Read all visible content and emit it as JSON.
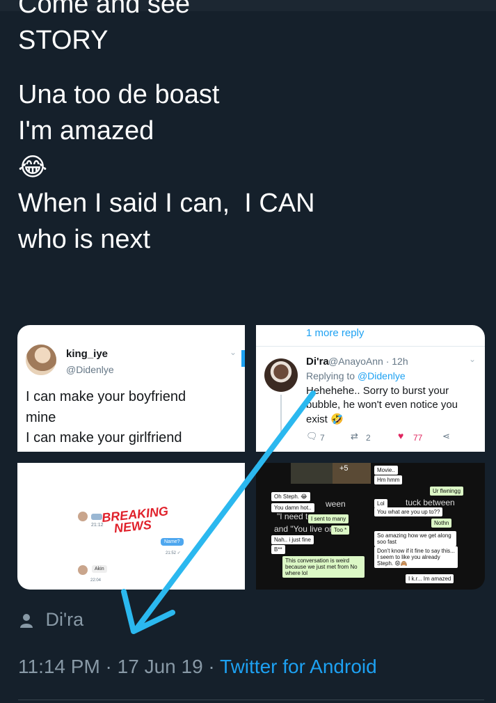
{
  "tweet": {
    "lines": [
      "Come and see",
      "STORY",
      "Una too de boast",
      "I'm amazed",
      "😂",
      "When I said I can,  I CAN",
      "who is next"
    ]
  },
  "media": {
    "tile1": {
      "name": "king_iye",
      "handle": "@Didenlye",
      "text1": "I can make your boyfriend",
      "text2": "mine",
      "text3": "I can make your girlfriend"
    },
    "tile2": {
      "more_reply": "1 more reply",
      "name": "Di'ra",
      "handle": "@AnayoAnn · 12h",
      "replying_prefix": "Replying to ",
      "replying_handle": "@Didenlye",
      "body1": "Hehehehe..  Sorry to burst your",
      "body2": "bubble, he won't even notice you",
      "body3": "exist 🤣",
      "reply_count": "7",
      "retweet_count": "2",
      "like_count": "77"
    },
    "tile3": {
      "time1": "21:12",
      "badge": "BREAKING",
      "badge2": "NEWS",
      "bubble_text": "Name?",
      "bubble_time": "21:52 ✓",
      "akin": "Akin",
      "time2": "22:04"
    },
    "tile4": {
      "plus": "+5",
      "messages": [
        "Movie..",
        "Hm hmm",
        "Ur flwningg",
        "Oh Steph. 😂",
        "You damn hot..",
        "ween",
        "Lol",
        "tuck between",
        "You what are you up to??",
        "\"I need to",
        "I sent to many",
        "Nothn",
        "and \"You live on",
        "Too *",
        "So amazing how we get along soo fast",
        "Nah.. i just fine",
        "B**",
        "Don't know if it fine to say this... I seem to like you already Steph. 😩🙈",
        "This conversation is weird because we just met from No where lol",
        "I k.r... Im amazed"
      ]
    }
  },
  "author": "Di'ra",
  "meta": {
    "time_date": "11:14 PM · 17 Jun 19 · ",
    "source": "Twitter for Android"
  },
  "colors": {
    "background": "#15202b",
    "link": "#1da1f2",
    "muted": "#8899a6",
    "annotation_arrow": "#2bb8ef"
  }
}
